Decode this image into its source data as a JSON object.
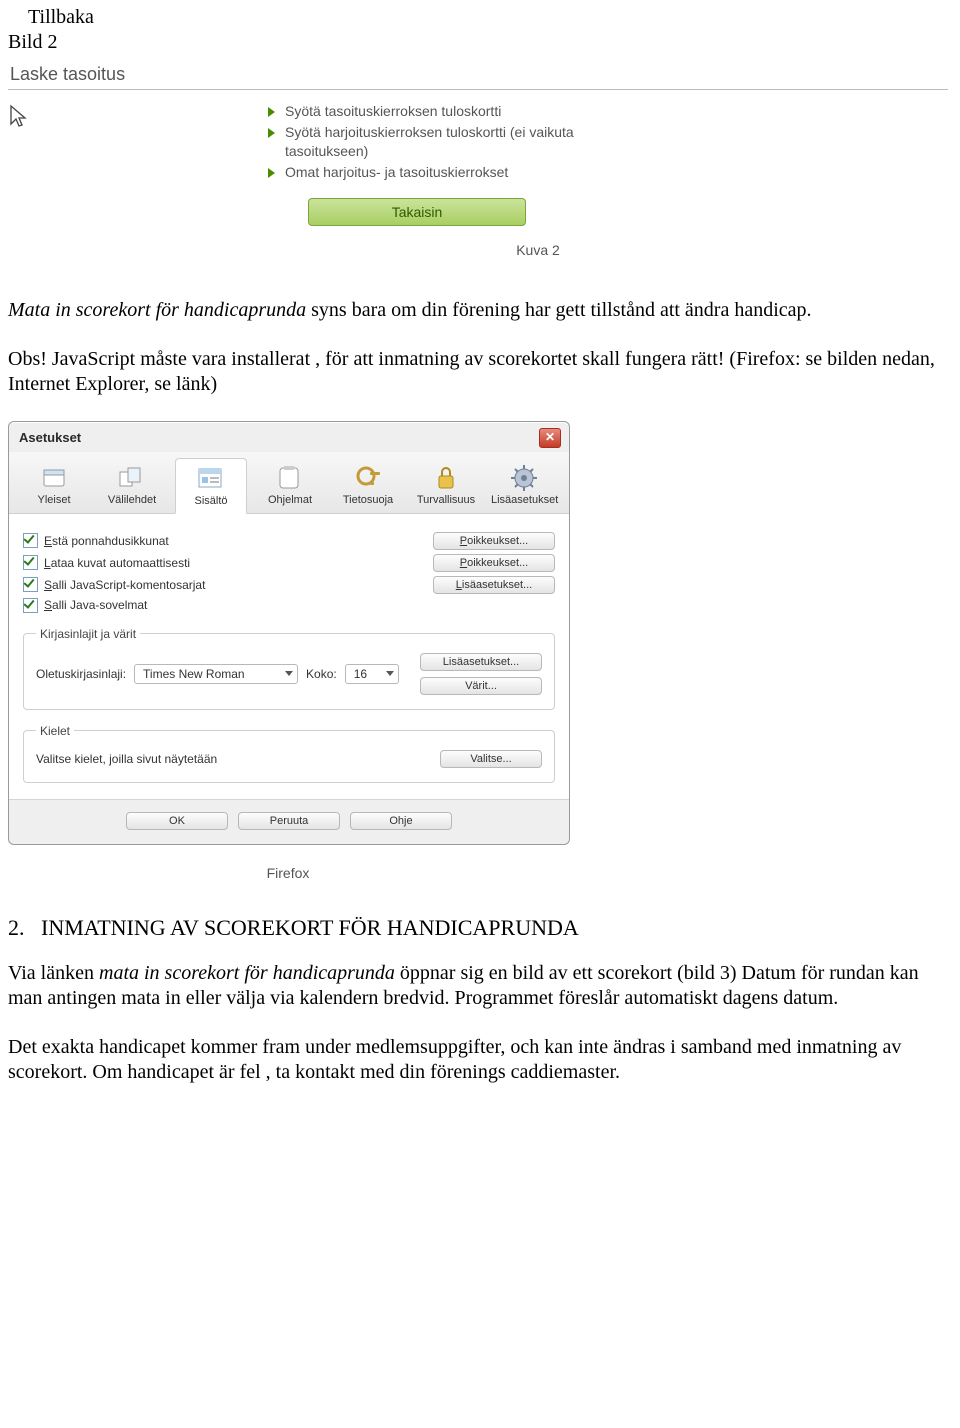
{
  "top": {
    "tillbaka": "Tillbaka",
    "bild": "Bild 2"
  },
  "embed1": {
    "heading": "Laske tasoitus",
    "links": [
      "Syötä tasoituskierroksen tuloskortti",
      "Syötä harjoituskierroksen tuloskortti (ei vaikuta tasoitukseen)",
      "Omat harjoitus- ja tasoituskierrokset"
    ],
    "button": "Takaisin",
    "caption": "Kuva 2"
  },
  "para1": {
    "lead_italic": "Mata in scorekort för handicaprunda",
    "rest": " syns bara om din förening har gett tillstånd att ändra handicap."
  },
  "para2": "Obs! JavaScript måste vara installerat , för att inmatning av scorekortet skall fungera rätt! (Firefox: se bilden nedan, Internet Explorer, se länk)",
  "dlg": {
    "title": "Asetukset",
    "tabs": [
      "Yleiset",
      "Välilehdet",
      "Sisältö",
      "Ohjelmat",
      "Tietosuoja",
      "Turvallisuus",
      "Lisäasetukset"
    ],
    "selected_tab_index": 2,
    "checks": [
      {
        "label": "Estä ponnahdusikkunat",
        "btn": "Poikkeukset..."
      },
      {
        "label": "Lataa kuvat automaattisesti",
        "btn": "Poikkeukset..."
      },
      {
        "label": "Salli JavaScript-komentosarjat",
        "btn": "Lisäasetukset..."
      },
      {
        "label": "Salli Java-sovelmat",
        "btn": ""
      }
    ],
    "fonts": {
      "legend": "Kirjasinlajit ja värit",
      "default_label": "Oletuskirjasinlaji:",
      "default_value": "Times New Roman",
      "size_label": "Koko:",
      "size_value": "16",
      "adv_btn": "Lisäasetukset...",
      "colors_btn": "Värit..."
    },
    "langs": {
      "legend": "Kielet",
      "text": "Valitse kielet, joilla sivut näytetään",
      "btn": "Valitse..."
    },
    "footer": {
      "ok": "OK",
      "cancel": "Peruuta",
      "help": "Ohje"
    },
    "caption": "Firefox"
  },
  "section": {
    "num": "2.",
    "title": "INMATNING AV SCOREKORT FÖR HANDICAPRUNDA"
  },
  "para3": {
    "pre": "Via länken ",
    "italic": "mata in scorekort för handicaprunda",
    "post": " öppnar sig en bild av ett scorekort (bild 3) Datum för rundan kan man antingen mata in eller välja via kalendern bredvid. Programmet föreslår automatiskt dagens datum."
  },
  "para4": "Det exakta handicapet  kommer fram under medlemsuppgifter, och kan inte ändras i samband med inmatning av scorekort. Om handicapet är fel , ta kontakt med din förenings caddiemaster."
}
